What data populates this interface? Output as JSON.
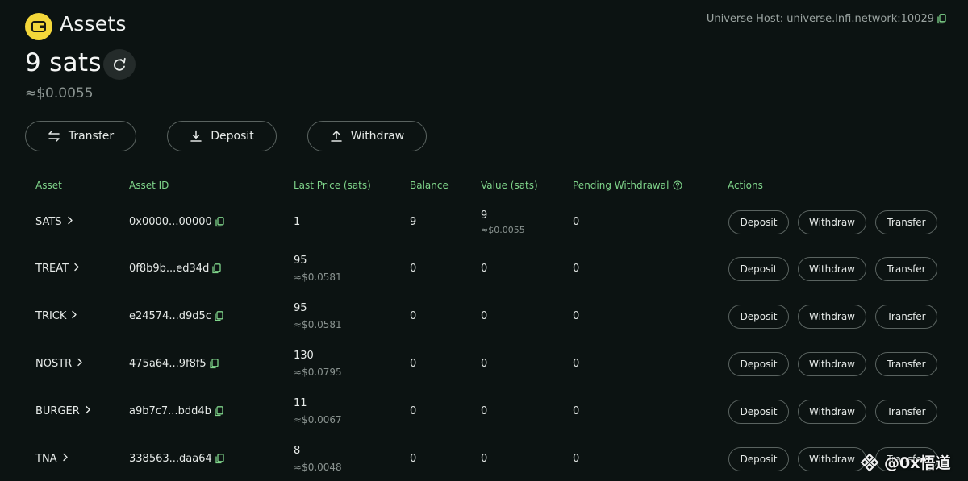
{
  "header": {
    "title": "Assets",
    "host_label": "Universe Host: universe.lnfi.network:10029",
    "balance": "9 sats",
    "balance_usd": "≈$0.0055"
  },
  "actions": {
    "transfer": "Transfer",
    "deposit": "Deposit",
    "withdraw": "Withdraw"
  },
  "table": {
    "headers": {
      "asset": "Asset",
      "asset_id": "Asset ID",
      "last_price": "Last Price (sats)",
      "balance": "Balance",
      "value": "Value (sats)",
      "pending": "Pending Withdrawal",
      "actions": "Actions"
    },
    "row_buttons": {
      "deposit": "Deposit",
      "withdraw": "Withdraw",
      "transfer": "Transfer"
    },
    "rows": [
      {
        "asset": "SATS",
        "asset_id": "0x0000...00000",
        "price": "1",
        "price_usd": "",
        "balance": "9",
        "value": "9",
        "value_usd": "≈$0.0055",
        "pending": "0"
      },
      {
        "asset": "TREAT",
        "asset_id": "0f8b9b...ed34d",
        "price": "95",
        "price_usd": "≈$0.0581",
        "balance": "0",
        "value": "0",
        "value_usd": "",
        "pending": "0"
      },
      {
        "asset": "TRICK",
        "asset_id": "e24574...d9d5c",
        "price": "95",
        "price_usd": "≈$0.0581",
        "balance": "0",
        "value": "0",
        "value_usd": "",
        "pending": "0"
      },
      {
        "asset": "NOSTR",
        "asset_id": "475a64...9f8f5",
        "price": "130",
        "price_usd": "≈$0.0795",
        "balance": "0",
        "value": "0",
        "value_usd": "",
        "pending": "0"
      },
      {
        "asset": "BURGER",
        "asset_id": "a9b7c7...bdd4b",
        "price": "11",
        "price_usd": "≈$0.0067",
        "balance": "0",
        "value": "0",
        "value_usd": "",
        "pending": "0"
      },
      {
        "asset": "TNA",
        "asset_id": "338563...daa64",
        "price": "8",
        "price_usd": "≈$0.0048",
        "balance": "0",
        "value": "0",
        "value_usd": "",
        "pending": "0"
      }
    ]
  },
  "watermark": "@0x悟道",
  "colors": {
    "background": "#0c1312",
    "accent_green": "#7fd48a",
    "logo_yellow": "#f4d73a",
    "border": "#5a6360"
  }
}
